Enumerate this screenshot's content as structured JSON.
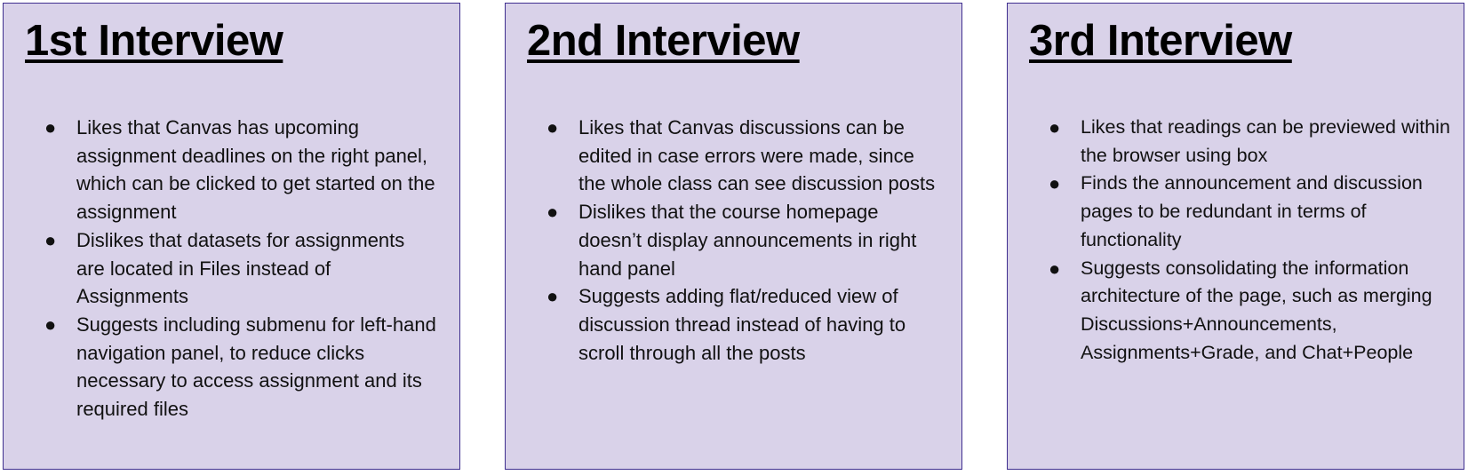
{
  "cards": [
    {
      "title": "1st Interview",
      "items": [
        "Likes that Canvas has upcoming assignment deadlines on the right panel, which can be clicked to get started on the assignment",
        "Dislikes that datasets for assignments are located in Files instead of Assignments",
        "Suggests including submenu for left-hand navigation panel, to reduce clicks necessary to access assignment and its required files"
      ]
    },
    {
      "title": "2nd Interview",
      "items": [
        "Likes that Canvas discussions can be edited in case errors were made, since the whole class can see discussion posts",
        "Dislikes that the course homepage doesn’t display announcements in right hand panel",
        "Suggests adding flat/reduced view of discussion thread instead of having to scroll through all the posts"
      ]
    },
    {
      "title": "3rd Interview",
      "items": [
        "Likes that readings can be previewed within the browser using box",
        "Finds the announcement and discussion pages to be redundant in terms of functionality",
        "Suggests consolidating the information architecture of the page, such as merging Discussions+Announcements, Assignments+Grade, and Chat+People"
      ]
    }
  ],
  "bullet_glyph": "●",
  "colors": {
    "card_background": "#d9d2e9",
    "card_border": "#3f2f8f",
    "text": "#111111"
  }
}
